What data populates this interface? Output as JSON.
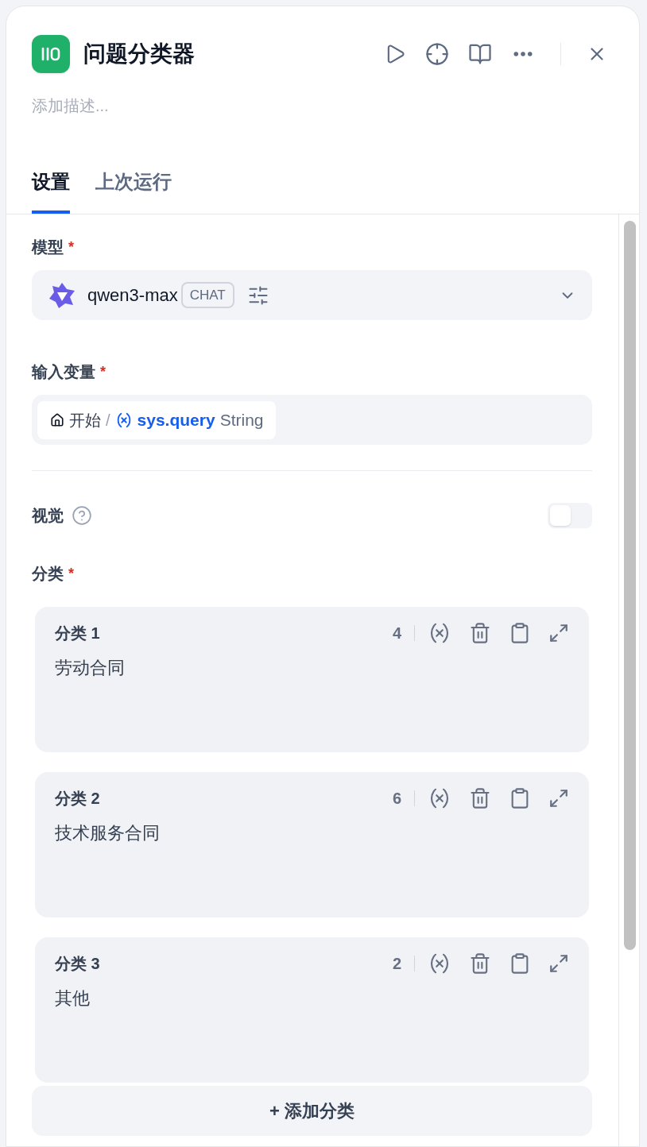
{
  "header": {
    "title": "问题分类器",
    "description_placeholder": "添加描述..."
  },
  "tabs": [
    {
      "label": "设置",
      "selected": true
    },
    {
      "label": "上次运行",
      "selected": false
    }
  ],
  "model": {
    "label": "模型",
    "required_mark": "*",
    "name": "qwen3-max",
    "mode": "CHAT"
  },
  "input_variable": {
    "label": "输入变量",
    "required_mark": "*",
    "node": "开始",
    "separator": "/",
    "variable": "sys.query",
    "type": "String"
  },
  "vision": {
    "label": "视觉",
    "on": false
  },
  "classes": {
    "label": "分类",
    "required_mark": "*",
    "items": [
      {
        "title": "分类 1",
        "count": "4",
        "text": "劳动合同"
      },
      {
        "title": "分类 2",
        "count": "6",
        "text": "技术服务合同"
      },
      {
        "title": "分类 3",
        "count": "2",
        "text": "其他"
      }
    ],
    "add_button": "+ 添加分类"
  }
}
